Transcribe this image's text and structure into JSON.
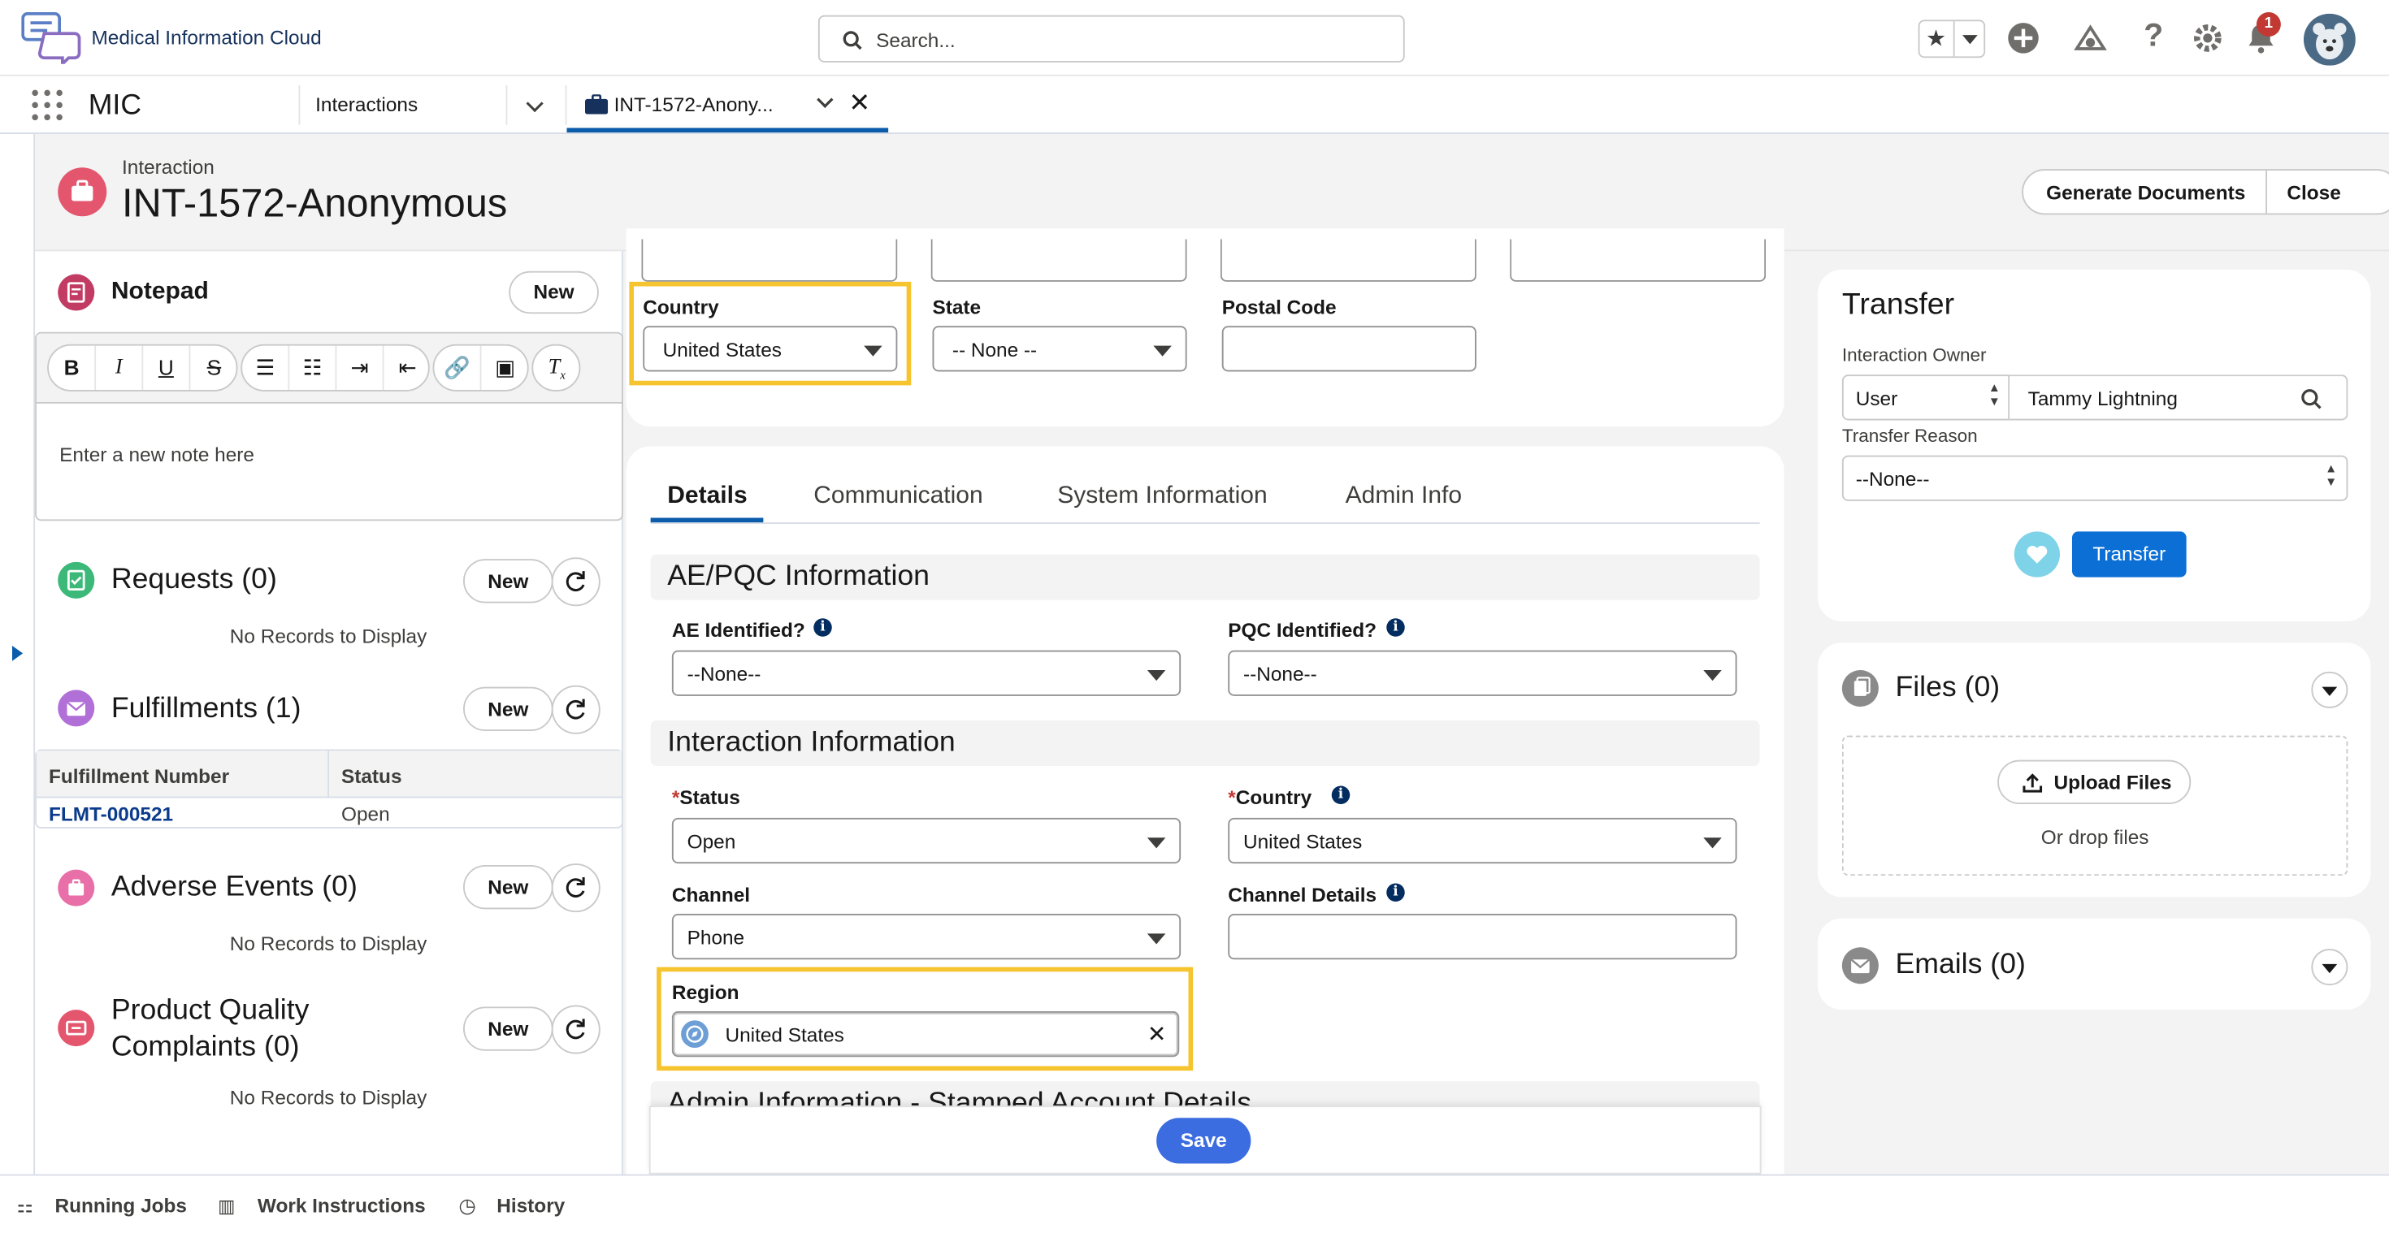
{
  "header": {
    "app_name": "Medical Information Cloud",
    "search_placeholder": "Search...",
    "notification_count": "1"
  },
  "nav": {
    "app_label": "MIC",
    "items": [
      {
        "label": "Interactions"
      }
    ],
    "active_tab": {
      "label": "INT-1572-Anony..."
    }
  },
  "record": {
    "object_type": "Interaction",
    "title": "INT-1572-Anonymous",
    "actions": [
      "Generate Documents",
      "Close"
    ]
  },
  "notepad": {
    "title": "Notepad",
    "new_label": "New",
    "placeholder": "Enter a new note here",
    "toolbar": [
      "B",
      "I",
      "U",
      "S"
    ]
  },
  "requests": {
    "title": "Requests (0)",
    "new_label": "New",
    "empty": "No Records to Display"
  },
  "fulfillments": {
    "title": "Fulfillments (1)",
    "new_label": "New",
    "columns": [
      "Fulfillment Number",
      "Status"
    ],
    "rows": [
      {
        "number": "FLMT-000521",
        "status": "Open"
      }
    ]
  },
  "adverse_events": {
    "title": "Adverse Events (0)",
    "new_label": "New",
    "empty": "No Records to Display"
  },
  "pqc": {
    "title_line1": "Product Quality",
    "title_line2": "Complaints (0)",
    "new_label": "New",
    "empty": "No Records to Display"
  },
  "address": {
    "country_label": "Country",
    "country_value": "United States",
    "state_label": "State",
    "state_value": "-- None --",
    "postal_label": "Postal Code"
  },
  "detail_tabs": [
    "Details",
    "Communication",
    "System Information",
    "Admin Info"
  ],
  "ae_section": {
    "title": "AE/PQC Information",
    "ae_label": "AE Identified?",
    "ae_value": "--None--",
    "pqc_label": "PQC Identified?",
    "pqc_value": "--None--"
  },
  "interaction_section": {
    "title": "Interaction Information",
    "status_label": "Status",
    "status_value": "Open",
    "country_label": "Country",
    "country_value": "United States",
    "channel_label": "Channel",
    "channel_value": "Phone",
    "channel_details_label": "Channel Details",
    "region_label": "Region",
    "region_value": "United States"
  },
  "admin_section": {
    "title": "Admin Information - Stamped Account Details"
  },
  "save_label": "Save",
  "transfer": {
    "title": "Transfer",
    "owner_label": "Interaction Owner",
    "owner_type": "User",
    "owner_value": "Tammy Lightning",
    "reason_label": "Transfer Reason",
    "reason_value": "--None--",
    "button_label": "Transfer"
  },
  "files": {
    "title": "Files (0)",
    "upload_label": "Upload Files",
    "drop_label": "Or drop files"
  },
  "emails": {
    "title": "Emails (0)"
  },
  "footer": {
    "items": [
      "Running Jobs",
      "Work Instructions",
      "History"
    ]
  },
  "colors": {
    "brand_blue": "#0b5cab",
    "highlight": "#f6c42e",
    "save_blue": "#3b6de0"
  }
}
